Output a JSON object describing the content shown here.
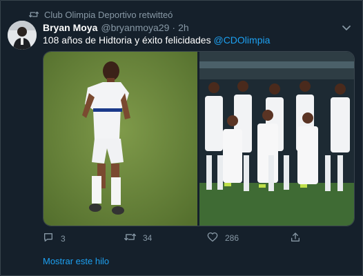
{
  "retweet": {
    "icon": "retweet-icon",
    "text": "Club Olimpia Deportivo retwitteó"
  },
  "tweet": {
    "author_name": "Bryan Moya",
    "author_handle": "@bryanmoya29",
    "separator": "·",
    "time": "2h",
    "text": "108 años de Hidtoria y éxito felicidades",
    "mention": "@CDOlimpia"
  },
  "actions": {
    "reply_count": "3",
    "retweet_count": "34",
    "like_count": "286"
  },
  "show_thread": "Mostrar este hilo",
  "colors": {
    "background": "#15202b",
    "accent": "#1da1f2",
    "muted": "#8899a6"
  }
}
